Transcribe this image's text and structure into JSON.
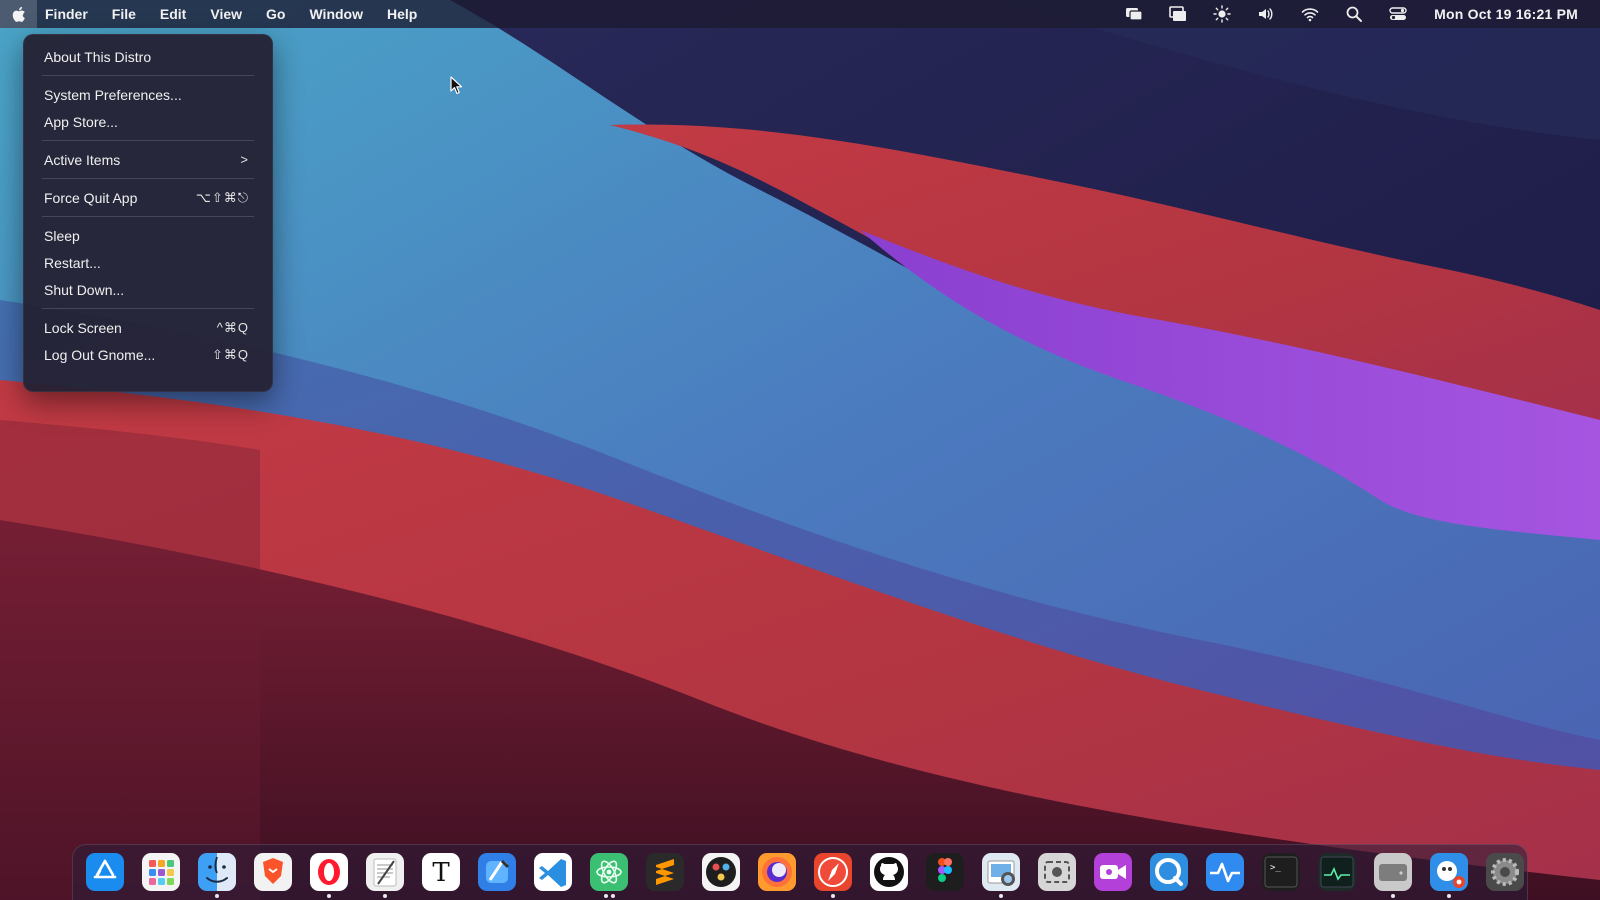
{
  "menubar": {
    "apple_icon": "apple-logo-icon",
    "menus": [
      "Finder",
      "File",
      "Edit",
      "View",
      "Go",
      "Window",
      "Help"
    ],
    "tray": [
      {
        "name": "screen-share-icon"
      },
      {
        "name": "windows-icon"
      },
      {
        "name": "brightness-icon"
      },
      {
        "name": "volume-icon"
      },
      {
        "name": "wifi-icon"
      },
      {
        "name": "search-icon"
      },
      {
        "name": "control-center-icon"
      }
    ],
    "clock": "Mon Oct 19  16:21 PM"
  },
  "apple_menu": {
    "items": [
      {
        "label": "About This Distro",
        "shortcut": ""
      },
      {
        "separator": true
      },
      {
        "label": "System Preferences...",
        "shortcut": ""
      },
      {
        "label": "App Store...",
        "shortcut": ""
      },
      {
        "separator": true
      },
      {
        "label": "Active Items",
        "shortcut": ">"
      },
      {
        "separator": true
      },
      {
        "label": "Force Quit App",
        "shortcut": "⌥⇧⌘⎋"
      },
      {
        "separator": true
      },
      {
        "label": "Sleep",
        "shortcut": ""
      },
      {
        "label": "Restart...",
        "shortcut": ""
      },
      {
        "label": "Shut Down...",
        "shortcut": ""
      },
      {
        "separator": true
      },
      {
        "label": "Lock Screen",
        "shortcut": "^⌘Q"
      },
      {
        "label": "Log Out Gnome...",
        "shortcut": "⇧⌘Q"
      }
    ]
  },
  "dock": {
    "items": [
      {
        "name": "app-store-icon",
        "bg": "#1a8cf0",
        "running": 0
      },
      {
        "name": "launchpad-icon",
        "bg": "#f4f4f4",
        "running": 0
      },
      {
        "name": "finder-icon",
        "bg": "#3ea0f5",
        "running": 1
      },
      {
        "name": "brave-browser-icon",
        "bg": "#f2f2f2",
        "running": 0
      },
      {
        "name": "opera-browser-icon",
        "bg": "#ffffff",
        "running": 1
      },
      {
        "name": "text-editor-icon",
        "bg": "#f0f0f0",
        "running": 1
      },
      {
        "name": "typora-icon",
        "bg": "#ffffff",
        "running": 0
      },
      {
        "name": "xcode-icon",
        "bg": "#2f7fe6",
        "running": 0
      },
      {
        "name": "vscode-icon",
        "bg": "#ffffff",
        "running": 0
      },
      {
        "name": "atom-editor-icon",
        "bg": "#3bbf73",
        "running": 2
      },
      {
        "name": "sublime-text-icon",
        "bg": "#2a2a2a",
        "running": 0
      },
      {
        "name": "davinci-resolve-icon",
        "bg": "#f4f4f4",
        "running": 0
      },
      {
        "name": "firefox-browser-icon",
        "bg": "#ff9a2e",
        "running": 0
      },
      {
        "name": "safari-browser-icon",
        "bg": "#e8452c",
        "running": 1
      },
      {
        "name": "github-desktop-icon",
        "bg": "#ffffff",
        "running": 0
      },
      {
        "name": "figma-icon",
        "bg": "#1e1e1e",
        "running": 0
      },
      {
        "name": "preview-icon",
        "bg": "#dfe9f2",
        "running": 1
      },
      {
        "name": "screenshot-icon",
        "bg": "#d6d6d6",
        "running": 0
      },
      {
        "name": "video-recorder-icon",
        "bg": "#b340d8",
        "running": 0
      },
      {
        "name": "quicktime-icon",
        "bg": "#2e8ee0",
        "running": 0
      },
      {
        "name": "activity-pulse-icon",
        "bg": "#2f8bf0",
        "running": 0
      },
      {
        "name": "terminal-icon",
        "bg": "#1e1e1e",
        "running": 0
      },
      {
        "name": "system-monitor-icon",
        "bg": "#1e2a28",
        "running": 0
      },
      {
        "name": "drive-icon",
        "bg": "#c9c9c9",
        "running": 1
      },
      {
        "name": "gimp-icon",
        "bg": "#2f8fe8",
        "running": 1
      },
      {
        "name": "system-settings-icon",
        "bg": "#4a4a4a",
        "running": 0
      }
    ]
  }
}
